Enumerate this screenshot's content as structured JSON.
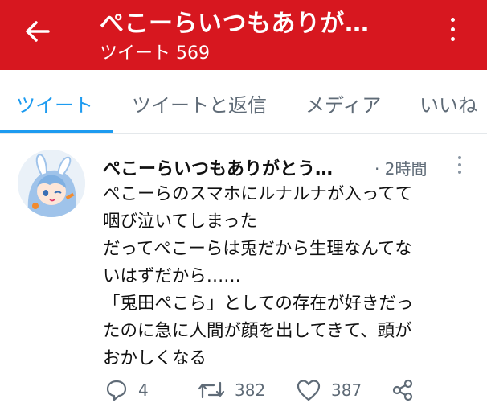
{
  "header": {
    "title": "ぺこーらいつもありが…",
    "subtitle": "ツイート 569",
    "back_icon": "arrow-left-icon",
    "more_icon": "more-vertical-icon",
    "bg_color": "#d7171f"
  },
  "tabs": [
    {
      "label": "ツイート",
      "active": true
    },
    {
      "label": "ツイートと返信",
      "active": false
    },
    {
      "label": "メディア",
      "active": false
    },
    {
      "label": "いいね",
      "active": false
    }
  ],
  "tweet": {
    "name": "ぺこーらいつもありがとう…",
    "time": "· 2時間",
    "lines": [
      "ぺこーらのスマホにルナルナが入ってて",
      "咽び泣いてしまった",
      "だってぺこーらは兎だから生理なんてな",
      "いはずだから……",
      "「兎田ぺこら」としての存在が好きだっ",
      "たのに急に人間が顔を出してきて、頭が",
      "おかしくなる"
    ],
    "reply_count": "4",
    "retweet_count": "382",
    "like_count": "387"
  },
  "accent_color": "#1d9bf0"
}
